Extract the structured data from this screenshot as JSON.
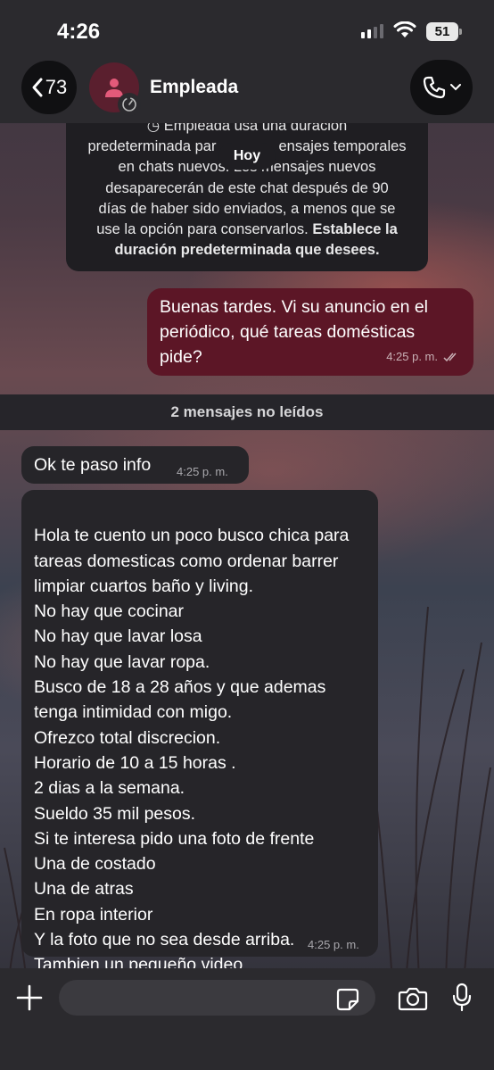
{
  "status_bar": {
    "time": "4:26",
    "battery": "51"
  },
  "header": {
    "back_count": "73",
    "contact_name": "Empleada"
  },
  "system_notice": {
    "line1": "Empleada usa una duración",
    "line2_a": "predeterminada par",
    "line2_b": "ensajes temporales",
    "line3": "en chats nuevos. Los mensajes nuevos",
    "line4": "desaparecerán de este chat después de 90",
    "line5": "días de haber sido enviados, a menos que se",
    "line6": "use la opción para conservarlos.",
    "link_a": "Establece la",
    "link_b": "duración predeterminada que desees."
  },
  "date_chip": "Hoy",
  "messages": {
    "outgoing": {
      "text": "Buenas tardes. Vi su anuncio en el periódico, qué tareas domésticas pide?",
      "time": "4:25 p. m."
    },
    "unread_divider": "2 mensajes no leídos",
    "incoming_1": {
      "text": "Ok te paso info",
      "time": "4:25 p. m."
    },
    "incoming_2": {
      "text": "Hola te cuento un poco busco chica para tareas domesticas como ordenar barrer limpiar cuartos baño y living.\nNo hay que cocinar\nNo hay que lavar losa\nNo hay que lavar ropa.\nBusco de 18 a 28 años y que ademas tenga intimidad con migo.\nOfrezco total discrecion.\nHorario de 10 a 15 horas .\n2 dias a la semana.\nSueldo 35 mil pesos.\nSi te interesa pido una foto de frente\nUna de costado\nUna de atras\nEn ropa interior\nY la foto que no sea desde arriba.\nTambien un pequeño video",
      "time": "4:25 p. m."
    }
  },
  "icons": {
    "back": "chevron-left-icon",
    "avatar": "person-icon",
    "timer": "timer-icon",
    "call": "phone-icon",
    "add": "plus-icon",
    "sticker": "sticker-icon",
    "camera": "camera-icon",
    "mic": "microphone-icon",
    "read_receipt": "double-check-icon"
  },
  "colors": {
    "outgoing_bubble": "#5c1626",
    "incoming_bubble": "#262529",
    "avatar_bg": "#5a1f2e"
  }
}
